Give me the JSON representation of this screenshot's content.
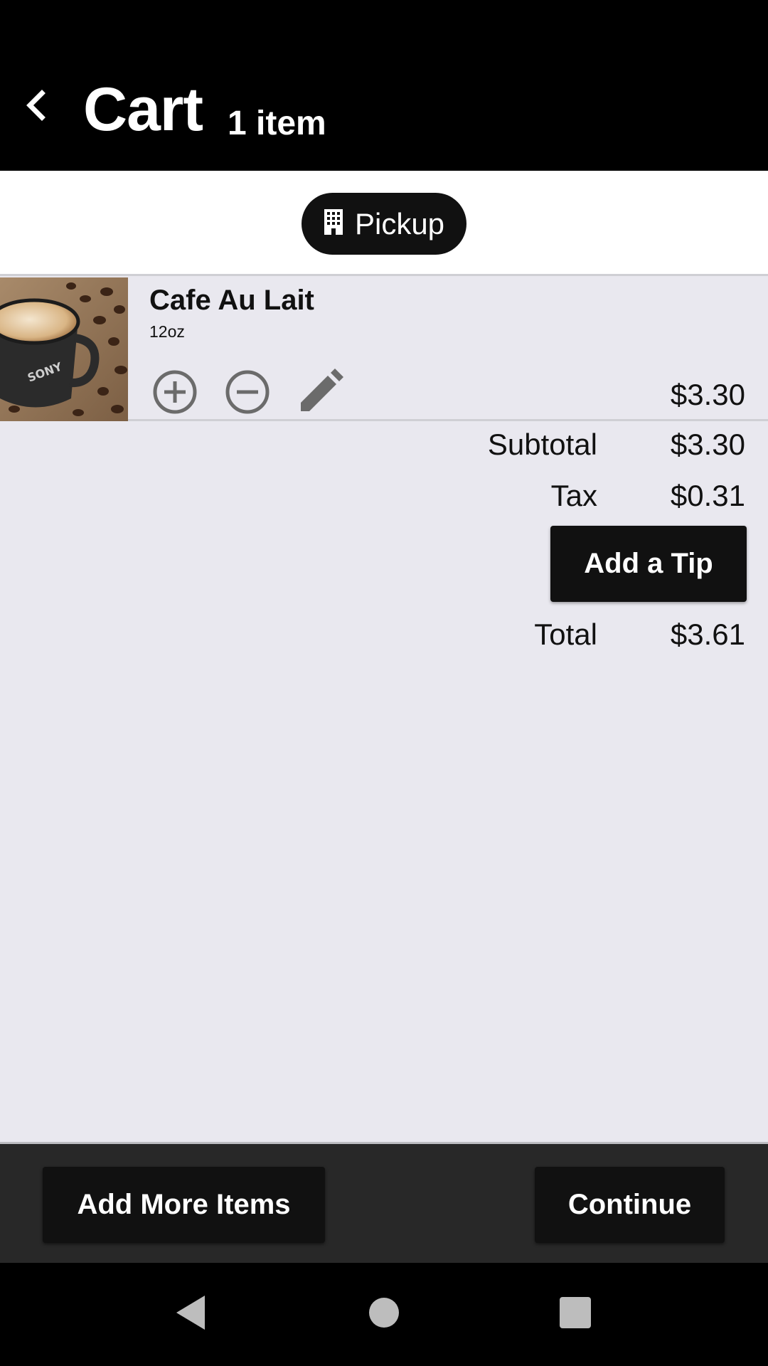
{
  "header": {
    "title": "Cart",
    "item_count": "1 item"
  },
  "mode": {
    "label": "Pickup",
    "icon": "building-icon"
  },
  "cart_items": [
    {
      "name": "Cafe Au Lait",
      "size": "12oz",
      "price": "$3.30",
      "image": "coffee-cup-image"
    }
  ],
  "summary": {
    "subtotal_label": "Subtotal",
    "subtotal_value": "$3.30",
    "tax_label": "Tax",
    "tax_value": "$0.31",
    "tip_button": "Add a Tip",
    "total_label": "Total",
    "total_value": "$3.61"
  },
  "footer": {
    "add_more_label": "Add More Items",
    "continue_label": "Continue"
  },
  "colors": {
    "header_bg": "#000000",
    "content_bg": "#e9e8ef",
    "button_bg": "#111111",
    "footer_bg": "#282828"
  }
}
